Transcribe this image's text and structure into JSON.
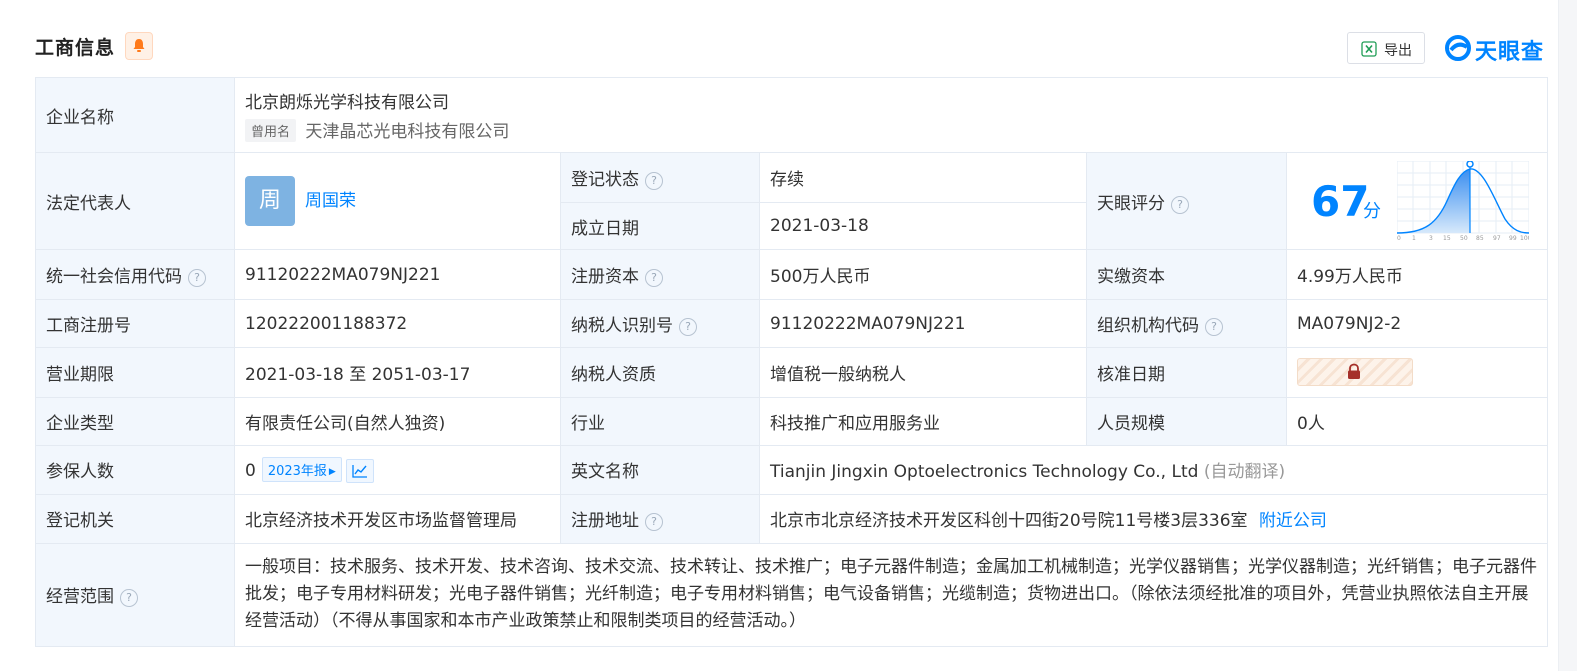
{
  "header": {
    "title": "工商信息",
    "export_label": "导出",
    "brand_logo": "天眼查",
    "icons": {
      "bell": "bell-icon",
      "excel": "excel-icon",
      "brand": "tianyancha-logo-icon"
    },
    "colors": {
      "brand_blue": "#0084ff",
      "bell_orange": "#ff7a1a",
      "key_cell_bg": "#f2f7fd",
      "status_green": "#1bad4f"
    }
  },
  "company": {
    "name_label": "企业名称",
    "name": "北京朗烁光学科技有限公司",
    "former_tag": "曾用名",
    "former_name": "天津晶芯光电科技有限公司"
  },
  "legal": {
    "label": "法定代表人",
    "avatar_char": "周",
    "name": "周国荣"
  },
  "status": {
    "reg_status_label": "登记状态",
    "reg_status": "存续",
    "founded_label": "成立日期",
    "founded": "2021-03-18"
  },
  "score": {
    "label": "天眼评分",
    "value": "67",
    "unit": "分",
    "ticks": [
      "0",
      "1",
      "3",
      "15",
      "50",
      "85",
      "97",
      "99",
      "100"
    ],
    "percentile_position": 0.5
  },
  "rows": {
    "credit_code_label": "统一社会信用代码",
    "credit_code": "91120222MA079NJ221",
    "reg_capital_label": "注册资本",
    "reg_capital": "500万人民币",
    "paid_capital_label": "实缴资本",
    "paid_capital": "4.99万人民币",
    "reg_no_label": "工商注册号",
    "reg_no": "120222001188372",
    "taxpayer_id_label": "纳税人识别号",
    "taxpayer_id": "91120222MA079NJ221",
    "org_code_label": "组织机构代码",
    "org_code": "MA079NJ2-2",
    "term_label": "营业期限",
    "term": "2021-03-18 至 2051-03-17",
    "tax_qual_label": "纳税人资质",
    "tax_qual": "增值税一般纳税人",
    "approve_label": "核准日期",
    "type_label": "企业类型",
    "type": "有限责任公司(自然人独资)",
    "industry_label": "行业",
    "industry": "科技推广和应用服务业",
    "staff_label": "人员规模",
    "staff": "0人",
    "insured_label": "参保人数",
    "insured": "0",
    "insured_year": "2023年报",
    "en_name_label": "英文名称",
    "en_name": "Tianjin Jingxin Optoelectronics Technology Co., Ltd",
    "en_name_note": "(自动翻译)",
    "authority_label": "登记机关",
    "authority": "北京经济技术开发区市场监督管理局",
    "address_label": "注册地址",
    "address": "北京市北京经济技术开发区科创十四街20号院11号楼3层336室",
    "nearby": "附近公司",
    "scope_label": "经营范围",
    "scope": "一般项目：技术服务、技术开发、技术咨询、技术交流、技术转让、技术推广；电子元器件制造；金属加工机械制造；光学仪器销售；光学仪器制造；光纤销售；电子元器件批发；电子专用材料研发；光电子器件销售；光纤制造；电子专用材料销售；电气设备销售；光缆制造；货物进出口。（除依法须经批准的项目外，凭营业执照依法自主开展经营活动）（不得从事国家和本市产业政策禁止和限制类项目的经营活动。）"
  }
}
